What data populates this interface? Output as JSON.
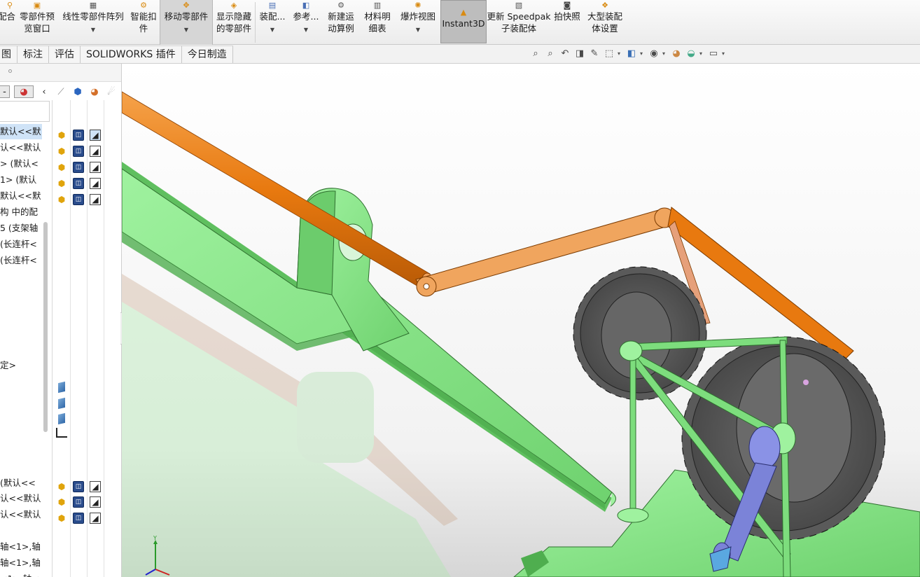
{
  "ribbon": {
    "items": [
      {
        "label": "配合",
        "sub": "",
        "icon": "mate-icon",
        "caret": false
      },
      {
        "label": "零部件预",
        "sub": "览窗口",
        "icon": "component-preview-icon",
        "caret": false
      },
      {
        "label": "线性零部件阵列",
        "sub": "",
        "icon": "linear-pattern-icon",
        "caret": true
      },
      {
        "label": "智能扣",
        "sub": "件",
        "icon": "smart-fasteners-icon",
        "caret": false
      },
      {
        "label": "移动零部件",
        "sub": "",
        "icon": "move-component-icon",
        "caret": true
      },
      {
        "label": "显示隐藏",
        "sub": "的零部件",
        "icon": "show-hidden-icon",
        "caret": false
      },
      {
        "label": "装配...",
        "sub": "",
        "icon": "assembly-features-icon",
        "caret": true
      },
      {
        "label": "参考...",
        "sub": "",
        "icon": "reference-geometry-icon",
        "caret": true
      },
      {
        "label": "新建运",
        "sub": "动算例",
        "icon": "motion-study-icon",
        "caret": false
      },
      {
        "label": "材料明",
        "sub": "细表",
        "icon": "bom-icon",
        "caret": false
      },
      {
        "label": "爆炸视图",
        "sub": "",
        "icon": "exploded-view-icon",
        "caret": true
      },
      {
        "label": "Instant3D",
        "sub": "",
        "icon": "instant3d-icon",
        "caret": false
      },
      {
        "label": "更新 Speedpak",
        "sub": "子装配体",
        "icon": "speedpak-icon",
        "caret": false
      },
      {
        "label": "拍快照",
        "sub": "",
        "icon": "snapshot-icon",
        "caret": false
      },
      {
        "label": "大型装配",
        "sub": "体设置",
        "icon": "large-assembly-icon",
        "caret": false
      }
    ]
  },
  "tabs": [
    "图",
    "标注",
    "评估",
    "SOLIDWORKS 插件",
    "今日制造"
  ],
  "heads_up_icons": [
    "zoom-to-fit-icon",
    "zoom-to-area-icon",
    "previous-view-icon",
    "section-view-icon",
    "dynamic-annotation-icon",
    "view-orientation-icon",
    "display-style-icon",
    "hide-show-items-icon",
    "edit-appearance-icon",
    "apply-scene-icon",
    "view-settings-icon"
  ],
  "tree": {
    "rows": [
      {
        "text": "默认<<默",
        "selected": true
      },
      {
        "text": "认<<默认",
        "selected": false
      },
      {
        "text": "> (默认<",
        "selected": false
      },
      {
        "text": "1> (默认",
        "selected": false
      },
      {
        "text": "默认<<默",
        "selected": false
      },
      {
        "text": "构 中的配",
        "selected": false
      },
      {
        "text": "5 (支架轴",
        "selected": false
      },
      {
        "text": "(长连杆<",
        "selected": false
      },
      {
        "text": "(长连杆<",
        "selected": false
      },
      {
        "text": "定>",
        "selected": false
      },
      {
        "text": "(默认<<",
        "selected": false
      },
      {
        "text": "认<<默认",
        "selected": false
      },
      {
        "text": "认<<默认",
        "selected": false
      },
      {
        "text": "轴<1>,轴",
        "selected": false
      },
      {
        "text": "轴<1>,轴",
        "selected": false
      },
      {
        "text": "<1>,轴<",
        "selected": false
      }
    ]
  },
  "triad": {
    "y_label": "Y"
  },
  "colors": {
    "rod_orange": "#e8790f",
    "link_orange": "#f0a55e",
    "base_green": "#7ddd7d",
    "gear_gray": "#5f5f5f",
    "crank_blue": "#7b83d8",
    "selection_blue": "#cfe3f7"
  }
}
